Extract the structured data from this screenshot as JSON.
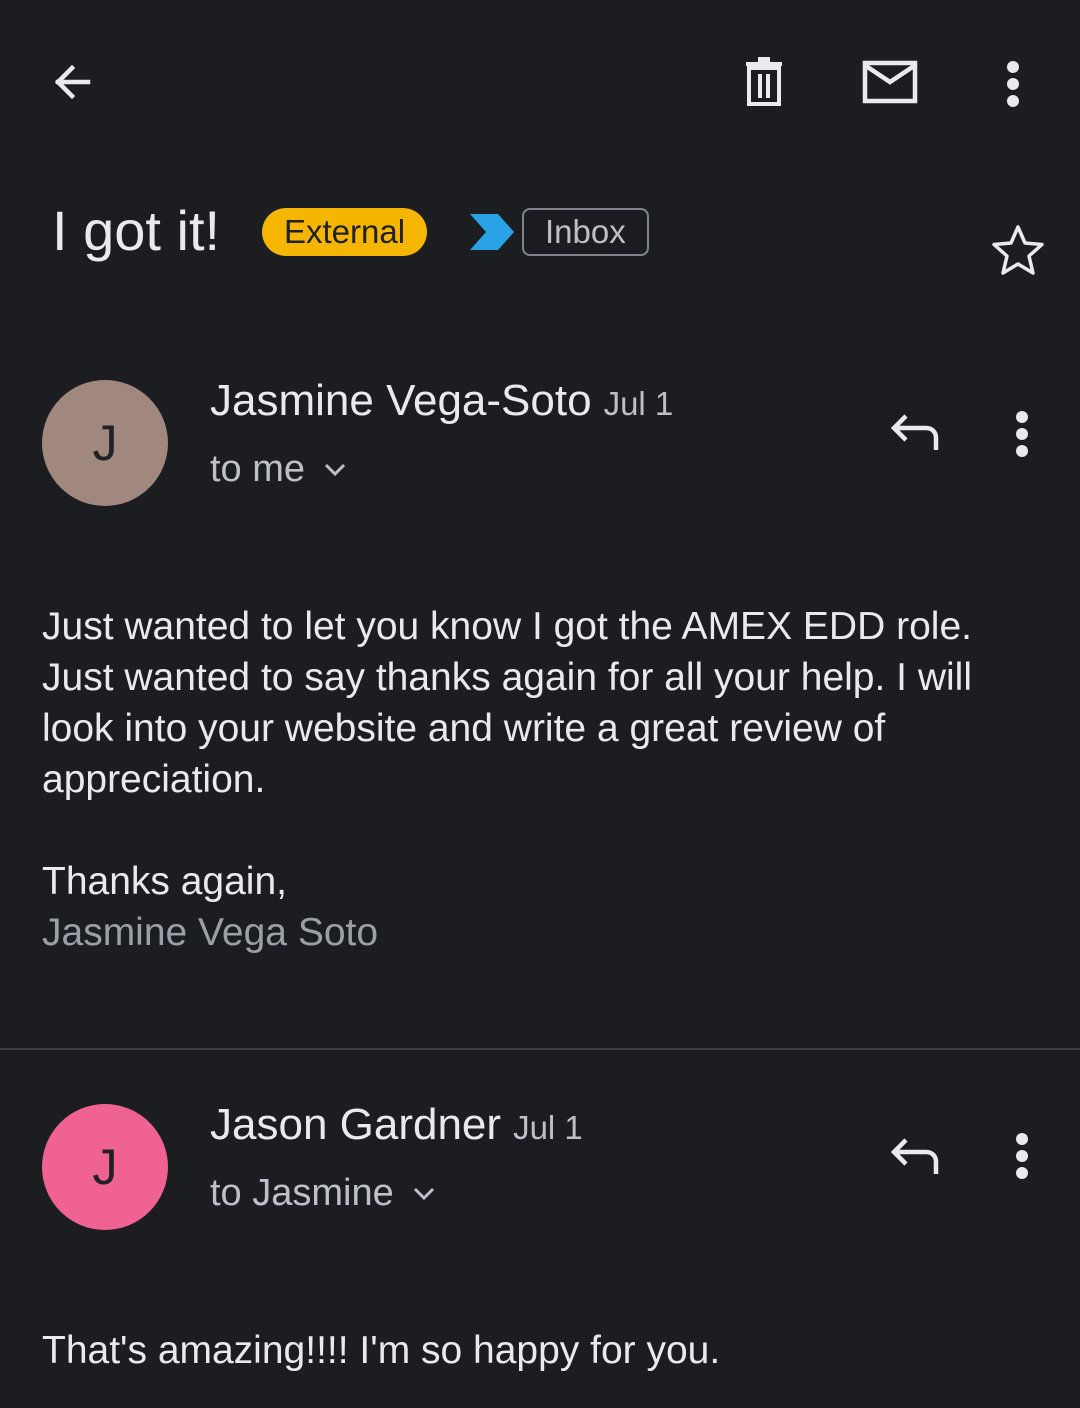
{
  "toolbar": {
    "back_icon": "arrow-left-icon",
    "delete_icon": "trash-icon",
    "mark_unread_icon": "mail-icon",
    "more_icon": "more-vert-icon"
  },
  "subject": {
    "text": "I got it!",
    "external_label": "External",
    "inbox_label": "Inbox",
    "star_icon": "star-outline-icon",
    "colors": {
      "external_badge": "#f6b500",
      "important_marker": "#2aa3e6"
    }
  },
  "messages": [
    {
      "avatar_letter": "J",
      "avatar_color": "#a1887f",
      "sender": "Jasmine Vega-Soto",
      "date": "Jul 1",
      "recipients": "to me",
      "body": [
        "Just wanted to let you know I got the AMEX EDD role.",
        "Just wanted to say thanks again for all your help.  I will look into your website and write a great review of appreciation.",
        "",
        "Thanks again,"
      ],
      "signature": "Jasmine Vega Soto"
    },
    {
      "avatar_letter": "J",
      "avatar_color": "#f06292",
      "sender": "Jason Gardner",
      "date": "Jul 1",
      "recipients": "to Jasmine",
      "body": [
        "That's amazing!!!! I'm so happy for you."
      ]
    }
  ]
}
